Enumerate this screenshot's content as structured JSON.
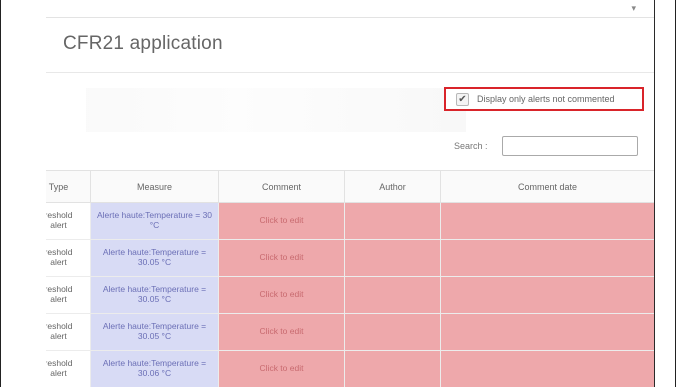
{
  "app": {
    "title": "CFR21 application"
  },
  "filter": {
    "checked": true,
    "label": "Display only alerts not commented"
  },
  "search": {
    "label": "Search :",
    "value": ""
  },
  "table": {
    "headers": {
      "type": "Type",
      "measure": "Measure",
      "comment": "Comment",
      "author": "Author",
      "comment_date": "Comment date"
    },
    "rows": [
      {
        "type_line1": "reshold",
        "type_line2": "alert",
        "measure": "Alerte haute:Temperature = 30 °C",
        "comment": "Click to edit",
        "author": "",
        "comment_date": ""
      },
      {
        "type_line1": "reshold",
        "type_line2": "alert",
        "measure": "Alerte haute:Temperature = 30.05 °C",
        "comment": "Click to edit",
        "author": "",
        "comment_date": ""
      },
      {
        "type_line1": "reshold",
        "type_line2": "alert",
        "measure": "Alerte haute:Temperature = 30.05 °C",
        "comment": "Click to edit",
        "author": "",
        "comment_date": ""
      },
      {
        "type_line1": "reshold",
        "type_line2": "alert",
        "measure": "Alerte haute:Temperature = 30.05 °C",
        "comment": "Click to edit",
        "author": "",
        "comment_date": ""
      },
      {
        "type_line1": "reshold",
        "type_line2": "alert",
        "measure": "Alerte haute:Temperature = 30.06 °C",
        "comment": "Click to edit",
        "author": "",
        "comment_date": ""
      }
    ]
  },
  "colors": {
    "highlight_border": "#d9242a",
    "measure_bg": "#d8dbf5",
    "uncommented_bg": "#eea8ab"
  }
}
